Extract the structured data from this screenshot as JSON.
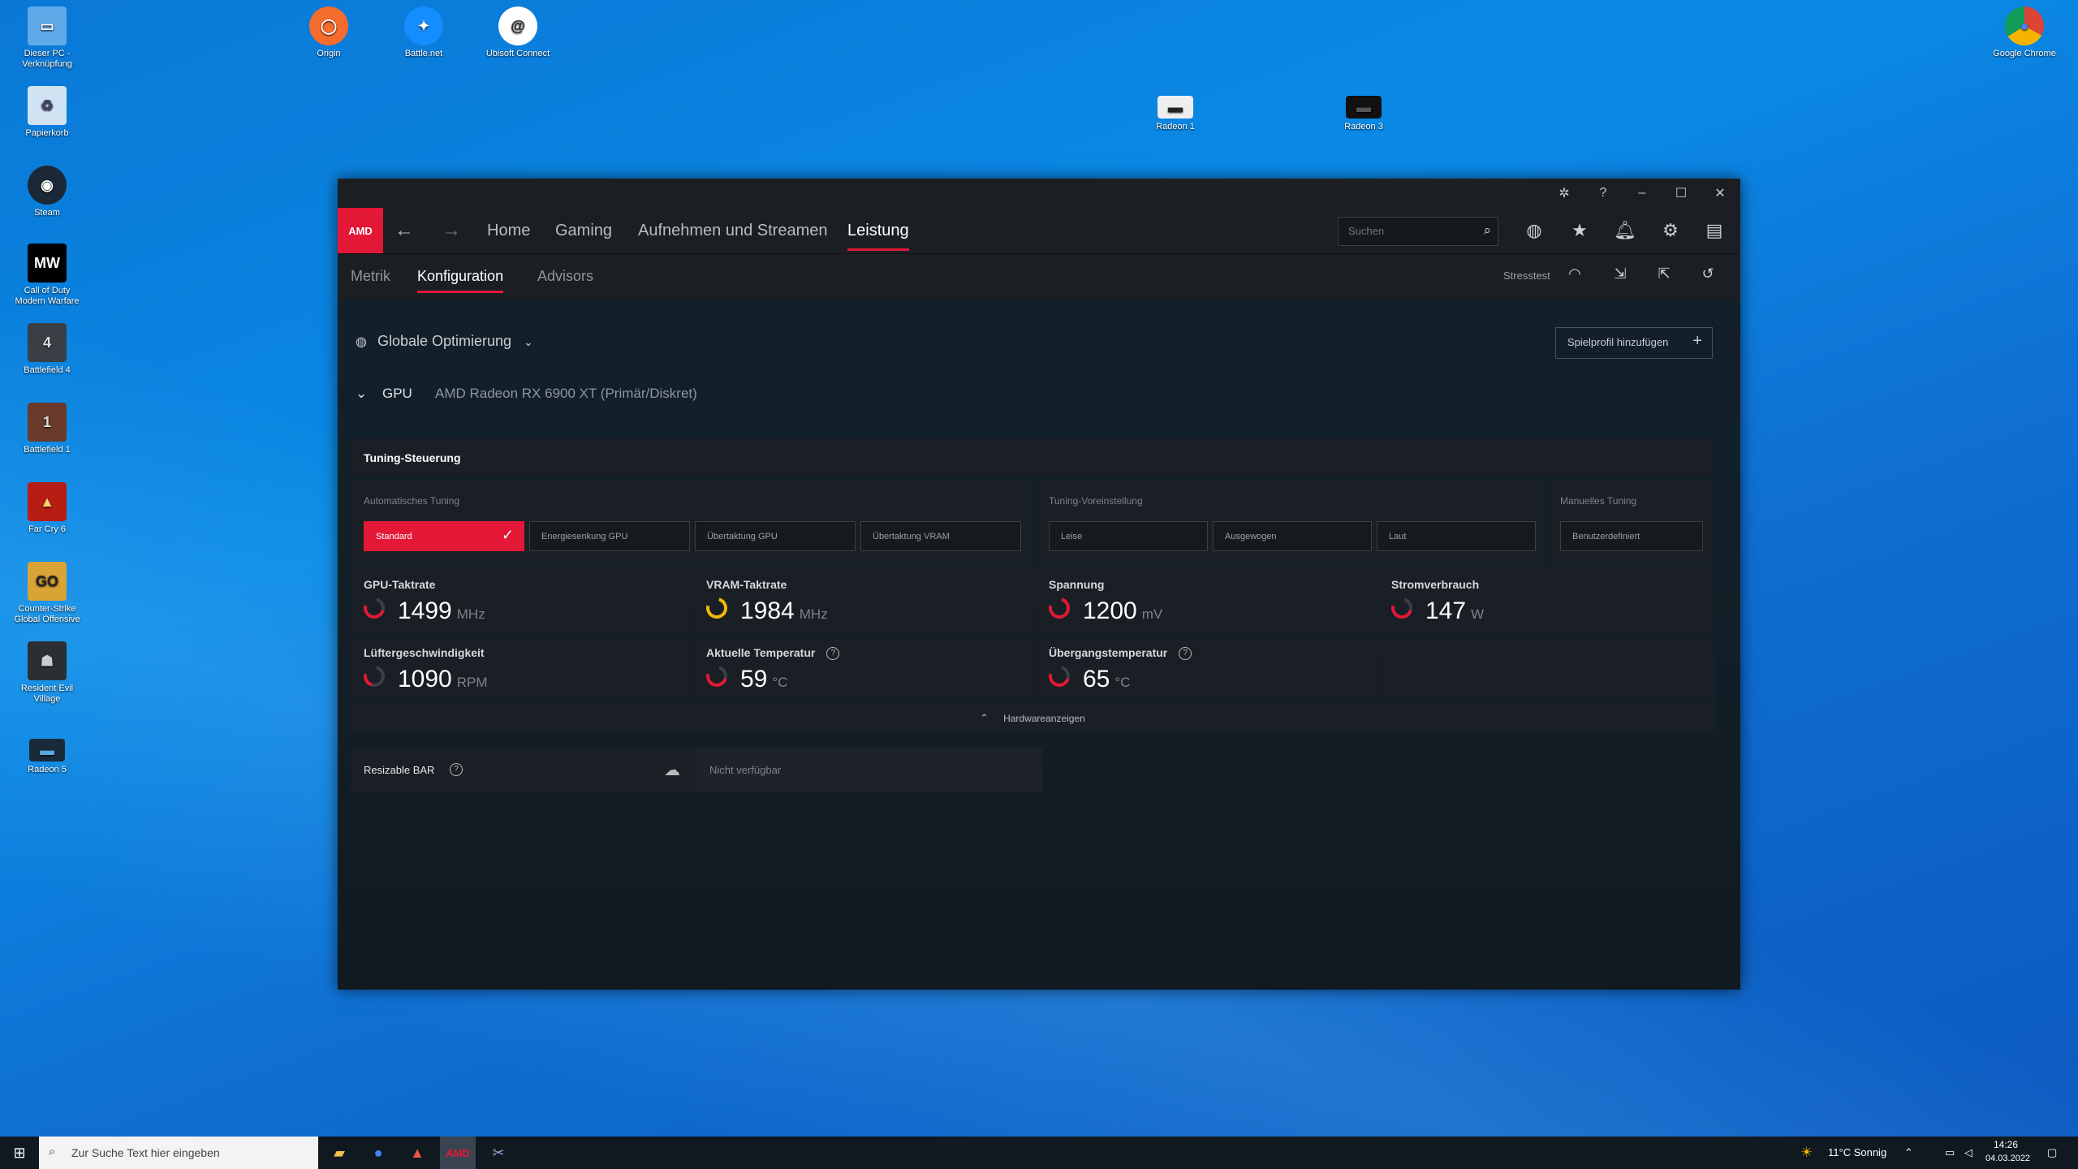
{
  "desktop": {
    "icons": [
      {
        "label": "Dieser PC - Verknüpfung",
        "icon": "pc-icon"
      },
      {
        "label": "Papierkorb",
        "icon": "recycle-bin-icon"
      },
      {
        "label": "Steam",
        "icon": "steam-icon"
      },
      {
        "label": "Call of Duty Modern Warfare",
        "icon": "mw-icon"
      },
      {
        "label": "Battlefield 4",
        "icon": "bf4-icon"
      },
      {
        "label": "Battlefield 1",
        "icon": "bf1-icon"
      },
      {
        "label": "Far Cry 6",
        "icon": "farcry-icon"
      },
      {
        "label": "Counter-Strike Global Offensive",
        "icon": "csgo-icon"
      },
      {
        "label": "Resident Evil Village",
        "icon": "re-icon"
      },
      {
        "label": "Radeon 5",
        "icon": "radeon-icon"
      },
      {
        "label": "Origin",
        "icon": "origin-icon"
      },
      {
        "label": "Battle.net",
        "icon": "battlenet-icon"
      },
      {
        "label": "Ubisoft Connect",
        "icon": "ubisoft-icon"
      },
      {
        "label": "Radeon 1",
        "icon": "radeon-icon"
      },
      {
        "label": "Radeon 3",
        "icon": "radeon-icon"
      },
      {
        "label": "Google Chrome",
        "icon": "chrome-icon"
      }
    ]
  },
  "app": {
    "logo": "AMD",
    "nav": {
      "tabs": [
        "Home",
        "Gaming",
        "Aufnehmen und Streamen",
        "Leistung"
      ],
      "active": "Leistung",
      "search_placeholder": "Suchen"
    },
    "subnav": {
      "tabs": [
        "Metrik",
        "Konfiguration",
        "Advisors"
      ],
      "active": "Konfiguration",
      "stresstest": "Stresstest"
    },
    "scope": "Globale Optimierung",
    "add_profile": "Spielprofil hinzufügen",
    "gpu_label": "GPU",
    "gpu_name": "AMD Radeon RX 6900 XT (Primär/Diskret)",
    "tuning": {
      "title": "Tuning-Steuerung",
      "auto_label": "Automatisches Tuning",
      "auto_options": [
        "Standard",
        "Energiesenkung GPU",
        "Übertaktung GPU",
        "Übertaktung VRAM"
      ],
      "preset_label": "Tuning-Voreinstellung",
      "preset_options": [
        "Leise",
        "Ausgewogen",
        "Laut"
      ],
      "manual_label": "Manuelles Tuning",
      "manual_options": [
        "Benutzerdefiniert"
      ]
    },
    "metrics": {
      "gpu_clock": {
        "label": "GPU-Taktrate",
        "value": "1499",
        "unit": "MHz"
      },
      "vram_clock": {
        "label": "VRAM-Taktrate",
        "value": "1984",
        "unit": "MHz"
      },
      "voltage": {
        "label": "Spannung",
        "value": "1200",
        "unit": "mV"
      },
      "power": {
        "label": "Stromverbrauch",
        "value": "147",
        "unit": "W"
      },
      "fan": {
        "label": "Lüftergeschwindigkeit",
        "value": "1090",
        "unit": "RPM"
      },
      "temp": {
        "label": "Aktuelle Temperatur",
        "value": "59",
        "unit": "°C"
      },
      "junction": {
        "label": "Übergangstemperatur",
        "value": "65",
        "unit": "°C"
      }
    },
    "hardware_toggle": "Hardwareanzeigen",
    "resizable_bar": {
      "label": "Resizable BAR",
      "status": "Nicht verfügbar"
    }
  },
  "taskbar": {
    "search_placeholder": "Zur Suche Text hier eingeben",
    "weather": "11°C  Sonnig",
    "time": "14:26",
    "date": "04.03.2022"
  }
}
